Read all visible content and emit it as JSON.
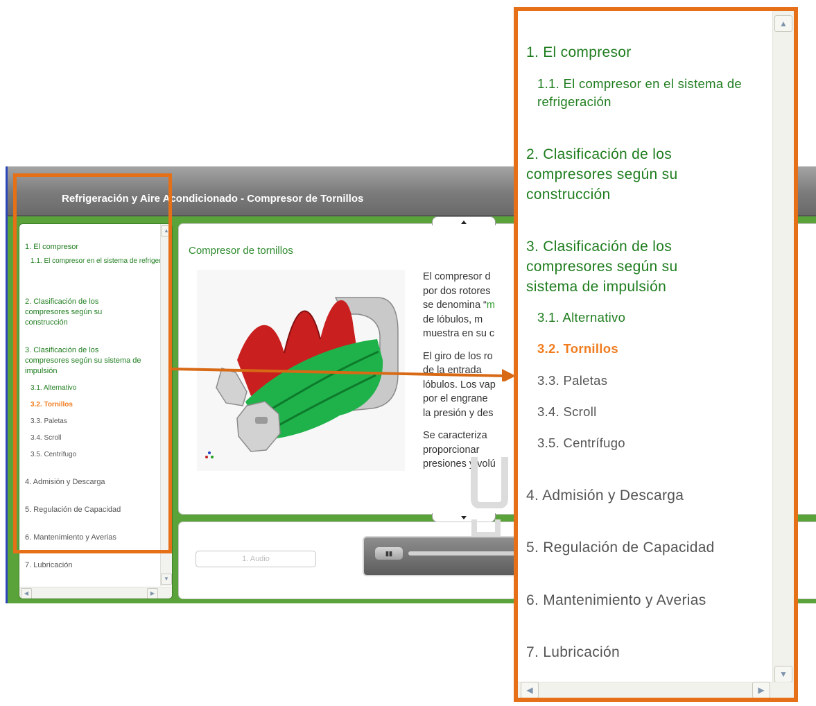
{
  "app": {
    "title": "Refrigeración y Aire Acondicionado - Compresor de Tornillos"
  },
  "menu": {
    "items": [
      {
        "label": "1. El compresor"
      },
      {
        "label": "1.1. El compresor en el sistema de refrigeración"
      },
      {
        "label": "2. Clasificación de los compresores según su construcción"
      },
      {
        "label": "3. Clasificación de los compresores según su sistema de impulsión"
      },
      {
        "label": "3.1. Alternativo"
      },
      {
        "label": "3.2. Tornillos"
      },
      {
        "label": "3.3. Paletas"
      },
      {
        "label": "3.4. Scroll"
      },
      {
        "label": "3.5. Centrífugo"
      },
      {
        "label": "4. Admisión y Descarga"
      },
      {
        "label": "5. Regulación de Capacidad"
      },
      {
        "label": "6. Mantenimiento y Averias"
      },
      {
        "label": "7. Lubricación"
      }
    ],
    "active_index": 5
  },
  "content": {
    "title": "Compresor de tornillos",
    "paragraphs": [
      "El compresor d",
      "por dos rotores",
      "se denomina “",
      "m",
      "de lóbulos, m",
      "muestra en su c",
      "El giro de los ro",
      "de la entrada",
      "lóbulos. Los vap",
      "por el engrane",
      "la presión y des",
      "Se caracteriza",
      "proporcionar",
      "presiones y volú"
    ]
  },
  "audio": {
    "track_label": "1. Audio"
  },
  "colors": {
    "active": "#f07c1e",
    "link": "#1f7d1f",
    "highlight_frame": "#e57018",
    "window_bg": "#5aa23a"
  }
}
